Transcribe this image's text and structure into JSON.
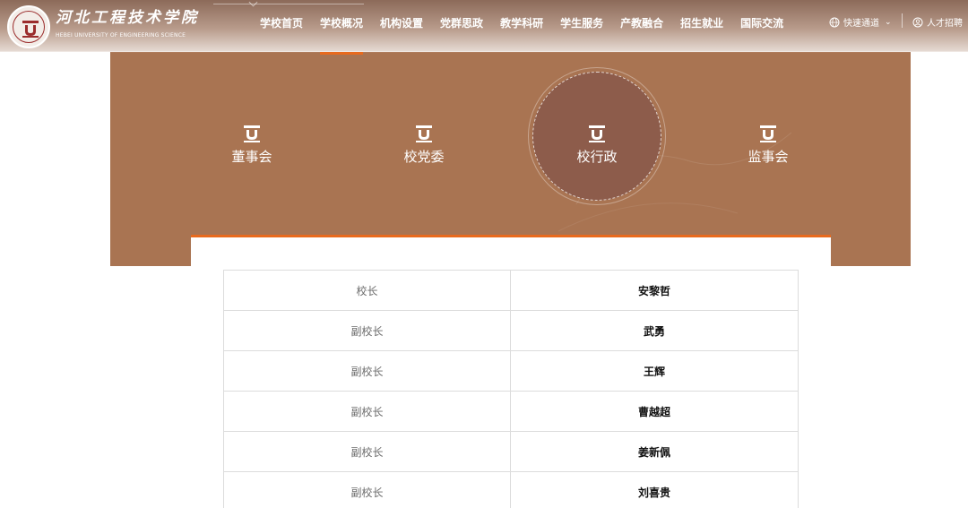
{
  "header": {
    "brand_cn": "河北工程技术学院",
    "brand_en": "HEBEI UNIVERSITY OF ENGINEERING SCIENCE",
    "nav": [
      "学校首页",
      "学校概况",
      "机构设置",
      "党群思政",
      "教学科研",
      "学生服务",
      "产教融合",
      "招生就业",
      "国际交流"
    ],
    "active_nav": "学校概况",
    "quick_label": "快速通道",
    "recruit_label": "人才招聘",
    "icons": {
      "quick": "globe-icon",
      "recruit": "user-circle-icon",
      "chevron": "chevron-down-icon"
    }
  },
  "tabs": [
    {
      "label": "董事会",
      "icon": "emblem-icon"
    },
    {
      "label": "校党委",
      "icon": "emblem-icon"
    },
    {
      "label": "校行政",
      "icon": "emblem-icon",
      "active": true
    },
    {
      "label": "监事会",
      "icon": "emblem-icon"
    }
  ],
  "table": {
    "rows": [
      {
        "role": "校长",
        "name": "安黎哲"
      },
      {
        "role": "副校长",
        "name": "武勇"
      },
      {
        "role": "副校长",
        "name": "王辉"
      },
      {
        "role": "副校长",
        "name": "曹越超"
      },
      {
        "role": "副校长",
        "name": "姜新佩"
      },
      {
        "role": "副校长",
        "name": "刘喜贵"
      }
    ]
  },
  "colors": {
    "banner": "#a97452",
    "active_circle": "#8d5c4b",
    "accent": "#e86a1e",
    "header": "#8c6a59"
  }
}
